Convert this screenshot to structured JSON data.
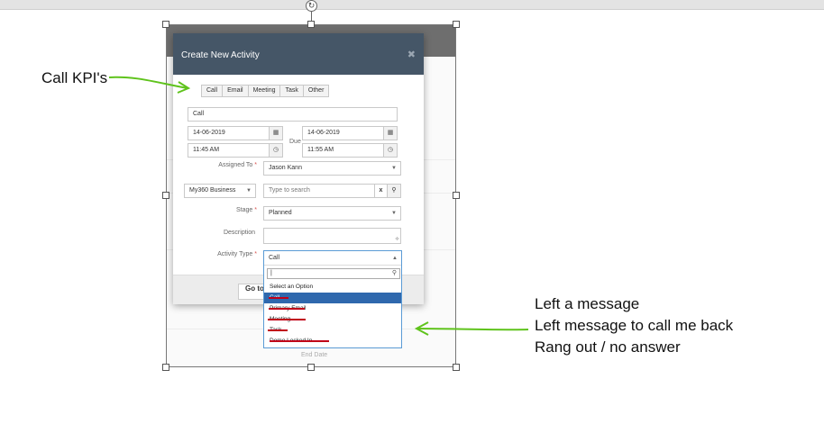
{
  "dialog": {
    "title": "Create New Activity",
    "close_icon": "close-icon",
    "kpi_tabs": [
      "Call",
      "Email",
      "Meeting",
      "Task",
      "Other"
    ],
    "subject_value": "Call",
    "start_date": "14-06-2019",
    "start_time": "11:45 AM",
    "due_label": "Due",
    "due_date": "14-06-2019",
    "due_time": "11:55 AM",
    "assigned_to_label": "Assigned To",
    "assigned_to_value": "Jason Kann",
    "related_type_value": "My360 Business",
    "related_search_placeholder": "Type to search",
    "clear_symbol": "x",
    "stage_label": "Stage",
    "stage_value": "Planned",
    "description_label": "Description",
    "activity_type_label": "Activity Type",
    "activity_type_value": "Call",
    "required_mark": "*",
    "footer_button": "Go to"
  },
  "dropdown": {
    "search_value": "|",
    "options": [
      "Select an Option",
      "Call",
      "Primary Email",
      "Meeting",
      "Task",
      "Demo Locked In"
    ],
    "highlighted_index": 1,
    "strike_color": "#c00018"
  },
  "annotations": {
    "kpi_label": "Call KPI's",
    "options_lines": [
      "Left a message",
      "Left message to call me back",
      "Rang out / no answer"
    ],
    "arrow_color": "#5fc31c"
  },
  "background": {
    "end_date_label": "End Date"
  },
  "colors": {
    "header": "#455667",
    "highlight": "#2f68ad",
    "required": "#d9534f"
  }
}
